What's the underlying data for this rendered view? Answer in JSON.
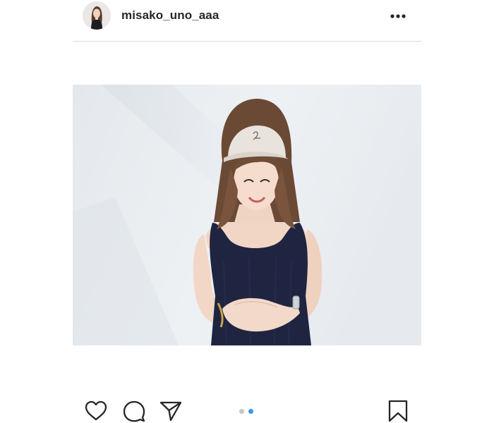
{
  "post": {
    "username": "misako_uno_aaa",
    "carousel": {
      "total": 2,
      "current": 2
    }
  },
  "icons": {
    "more": "more-options-icon",
    "like": "heart-icon",
    "comment": "comment-icon",
    "share": "paper-plane-icon",
    "save": "bookmark-icon"
  },
  "colors": {
    "text": "#262626",
    "divider": "#dbdbdb",
    "dot_active": "#3897f0",
    "dot_inactive": "#c7c7c7"
  }
}
